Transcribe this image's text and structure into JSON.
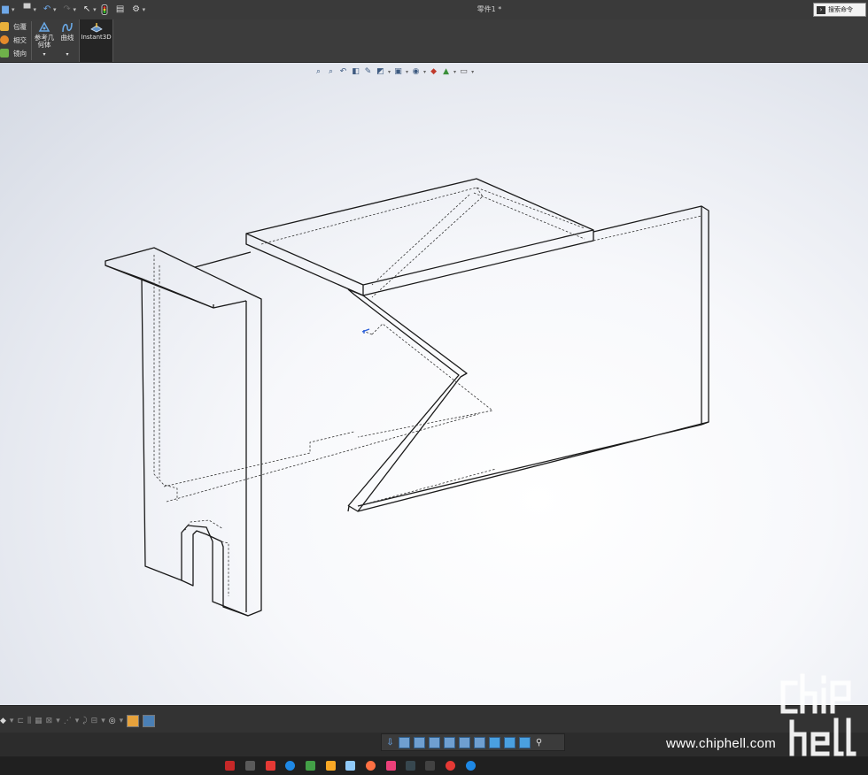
{
  "titlebar": {
    "doc_title": "零件1 *",
    "search_label": "搜索命令",
    "quick_access": [
      {
        "name": "save-icon",
        "glyph": "▆"
      },
      {
        "name": "print-icon",
        "glyph": "▀"
      },
      {
        "name": "undo-icon",
        "glyph": "↶"
      },
      {
        "name": "redo-icon",
        "glyph": "↷"
      },
      {
        "name": "select-icon",
        "glyph": "↖"
      },
      {
        "name": "rebuild-icon",
        "glyph": "⚑"
      },
      {
        "name": "file-properties-icon",
        "glyph": "▤"
      },
      {
        "name": "options-icon",
        "glyph": "⚙"
      }
    ]
  },
  "ribbon": {
    "small_commands": [
      "包覆",
      "相交",
      "镜向"
    ],
    "reference_geometry": "参考几\n何体",
    "curves": "曲线",
    "instant3d": "Instant3D"
  },
  "watermark": {
    "site": "www.chiphell.com",
    "logo_text": "chip hell"
  },
  "colors": {
    "accent": "#3d7bd9",
    "model_edges": "#1a1a1a"
  }
}
